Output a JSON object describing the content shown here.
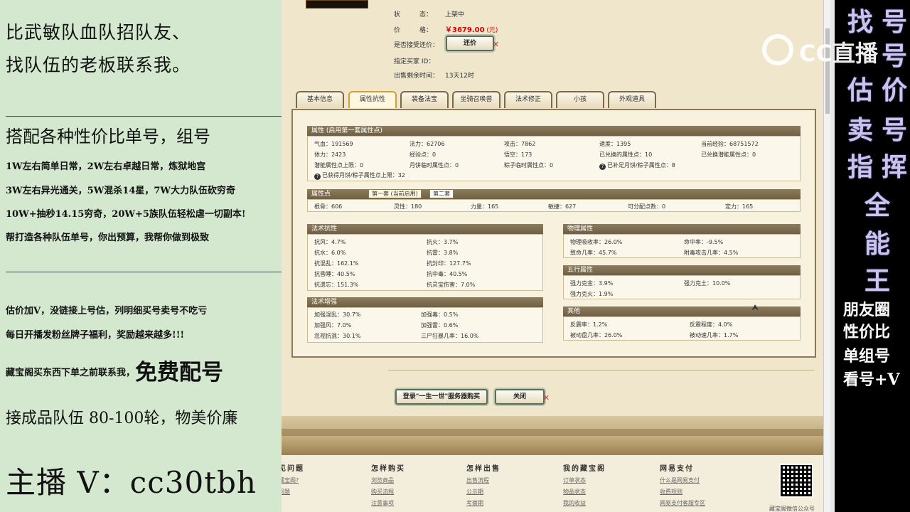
{
  "left_panel": {
    "line1": "比武敏队血队招队友、",
    "line2": "找队伍的老板联系我。",
    "line3": "搭配各种性价比单号，组号",
    "line4": "1W左右简单日常，2W左右卓越日常，炼狱地宫",
    "line5": "3W左右异光通关，5W混杀14星，7W大力队伍砍穷奇",
    "line6": "10W+抽秒14.15穷奇，20W+5族队伍轻松虐一切副本!",
    "line7": "帮打造各种队伍单号，你出预算，我帮你做到极致",
    "line8": "估价加V，没链接上号估，列明细买号卖号不吃亏",
    "line9": "每日开播发粉丝牌子福利，奖励越来越多!!!",
    "line10_prefix": "藏宝阁买东西下单之前联系我，",
    "line10_big": "免费配号",
    "line11": "接成品队伍 80-100轮，物美价廉",
    "anchor": "主播 V：cc30tbh"
  },
  "right_panel": {
    "col1": [
      "找",
      "卖",
      "指"
    ],
    "col1b": [
      "号"
    ],
    "col2": [
      "号",
      "价",
      "号",
      "挥"
    ],
    "col_mid": [
      "估",
      "全",
      "能",
      "王"
    ],
    "col_mid2": [
      "能"
    ],
    "lines": [
      "朋友圈",
      "性价比",
      "单组号",
      "看号+V"
    ]
  },
  "logo": {
    "text": "CC直播"
  },
  "item": {
    "status_label": "状　　　态：",
    "status_value": "上架中",
    "price_label": "价　　　格：",
    "price_value": "￥3679.00",
    "price_unit": "(元)",
    "accept_counter_label": "是否接受还价：",
    "counter_button": "还价",
    "buyer_id_label": "指定买家 ID：",
    "remaining_label": "出售剩余时间：",
    "remaining_value": "13天12时"
  },
  "tabs": [
    "基本信息",
    "属性抗性",
    "装备法宝",
    "坐骑召唤兽",
    "法术修正",
    "小孩",
    "外观道具"
  ],
  "attr_section": {
    "title": "属性 (启用第一套属性点)",
    "rows": [
      [
        "气血：191569",
        "法力：62706",
        "攻击：7862",
        "速度：1395",
        "当前经验：68751572"
      ],
      [
        "体力：2423",
        "经验点：0",
        "悟空：173",
        "已兑换的属性点：10",
        "已兑换潜能属性点：0"
      ],
      [
        "潜能属性点上限：0",
        "月饼临时属性点：0",
        "粽子临时属性点：0",
        "已补足月饼/粽子属性点：8",
        ""
      ],
      [
        "已获得月饼/粽子属性点上限：32",
        "",
        "",
        "",
        ""
      ]
    ]
  },
  "points_section": {
    "title": "属性点",
    "subtab1": "第一套 (当前启用)",
    "subtab2": "第二套",
    "row": [
      "根骨：606",
      "灵性：180",
      "力量：165",
      "敏捷：627",
      "可分配点数：0",
      "定力：165"
    ]
  },
  "resist_section": {
    "title": "法术抗性",
    "rows": [
      [
        "抗风：4.7%",
        "抗火：3.7%"
      ],
      [
        "抗水：6.0%",
        "抗雷：3.8%"
      ],
      [
        "抗混乱：162.1%",
        "抗封印：127.7%"
      ],
      [
        "抗昏睡：40.5%",
        "抗中毒：40.5%"
      ],
      [
        "抗遗忘：151.3%",
        "抗灵宝伤害：7.0%"
      ]
    ]
  },
  "boost_section": {
    "title": "法术增强",
    "rows": [
      [
        "加强混乱：30.7%",
        "加强毒：0.5%"
      ],
      [
        "加强风：7.0%",
        "加强雷：0.6%"
      ],
      [
        "忽视抗混：30.1%",
        "三尸狂暴几率：16.0%"
      ]
    ]
  },
  "physical_section": {
    "title": "物理属性",
    "rows": [
      [
        "物理吸收率：26.0%",
        "命中率：-9.5%"
      ],
      [
        "致命几率：45.7%",
        "附毒攻击几率：4.5%"
      ]
    ]
  },
  "elements_section": {
    "title": "五行属性",
    "rows": [
      [
        "强力克金：3.9%",
        "强力克土：10.0%"
      ],
      [
        "强力克火：1.9%",
        ""
      ]
    ]
  },
  "other_section": {
    "title": "其他",
    "rows": [
      [
        "反震率：1.2%",
        "反震程度：4.0%"
      ],
      [
        "被动盘几率：26.0%",
        "被动速几率：1.7%"
      ]
    ]
  },
  "buttons": {
    "login_buy": "登录\"一生一世\"服务器购买",
    "close": "关闭"
  },
  "footer": {
    "cols": [
      {
        "title": "见问题",
        "links": [
          "藏宝阁?",
          "问题"
        ]
      },
      {
        "title": "怎样购买",
        "links": [
          "浏览商品",
          "购买流程",
          "注意事项"
        ]
      },
      {
        "title": "怎样出售",
        "links": [
          "出售流程",
          "公示期",
          "考察期"
        ]
      },
      {
        "title": "我的藏宝阁",
        "links": [
          "订单状态",
          "物品状态",
          "我的收益"
        ]
      },
      {
        "title": "网易支付",
        "links": [
          "什么是网易支付",
          "收费规则",
          "网易支付客服专区"
        ]
      }
    ],
    "qr_caption": "藏宝阁微信公众号"
  }
}
